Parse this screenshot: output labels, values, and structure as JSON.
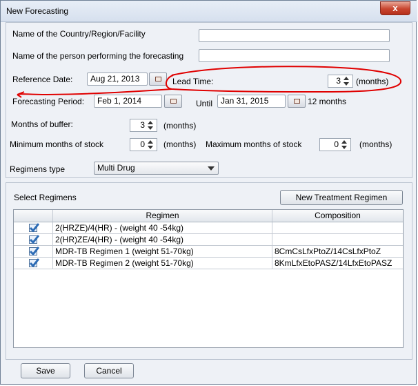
{
  "window": {
    "title": "New Forecasting",
    "close_glyph": "x"
  },
  "form": {
    "country_label": "Name of the Country/Region/Facility",
    "country_value": "",
    "person_label": "Name of the person performing the forecasting",
    "person_value": "",
    "reference_date_label": "Reference Date:",
    "reference_date_value": "Aug 21, 2013",
    "lead_time_label": "Lead Time:",
    "lead_time_value": "3",
    "lead_time_unit": "(months)",
    "forecasting_period_label": "Forecasting Period:",
    "forecasting_period_start": "Feb 1, 2014",
    "until_label": "Until",
    "forecasting_period_end": "Jan 31, 2015",
    "period_length": "12 months",
    "buffer_label": "Months of buffer:",
    "buffer_value": "3",
    "buffer_unit": "(months)",
    "min_stock_label": "Minimum months of stock",
    "min_stock_value": "0",
    "min_stock_unit": "(months)",
    "max_stock_label": "Maximum months of stock",
    "max_stock_value": "0",
    "max_stock_unit": "(months)",
    "regimens_type_label": "Regimens type",
    "regimens_type_value": "Multi Drug"
  },
  "regimens": {
    "section_label": "Select Regimens",
    "new_button": "New Treatment Regimen",
    "columns": [
      "Regimen",
      "Composition"
    ],
    "rows": [
      {
        "checked": true,
        "regimen": "2(HRZE)/4(HR) - (weight 40 -54kg)",
        "composition": ""
      },
      {
        "checked": true,
        "regimen": "2(HR)ZE/4(HR) - (weight 40 -54kg)",
        "composition": ""
      },
      {
        "checked": true,
        "regimen": "MDR-TB Regimen 1 (weight 51-70kg)",
        "composition": "8CmCsLfxPtoZ/14CsLfxPtoZ"
      },
      {
        "checked": true,
        "regimen": "MDR-TB Regimen 2 (weight 51-70kg)",
        "composition": "8KmLfxEtoPASZ/14LfxEtoPASZ"
      }
    ]
  },
  "footer": {
    "save_label": "Save",
    "cancel_label": "Cancel"
  },
  "colors": {
    "annotation": "#e00000",
    "checkbox": "#2d6cb5"
  },
  "icons": [
    "calendar-icon",
    "spinner-arrows-icon",
    "dropdown-caret-icon",
    "checkmark-icon",
    "close-icon"
  ]
}
